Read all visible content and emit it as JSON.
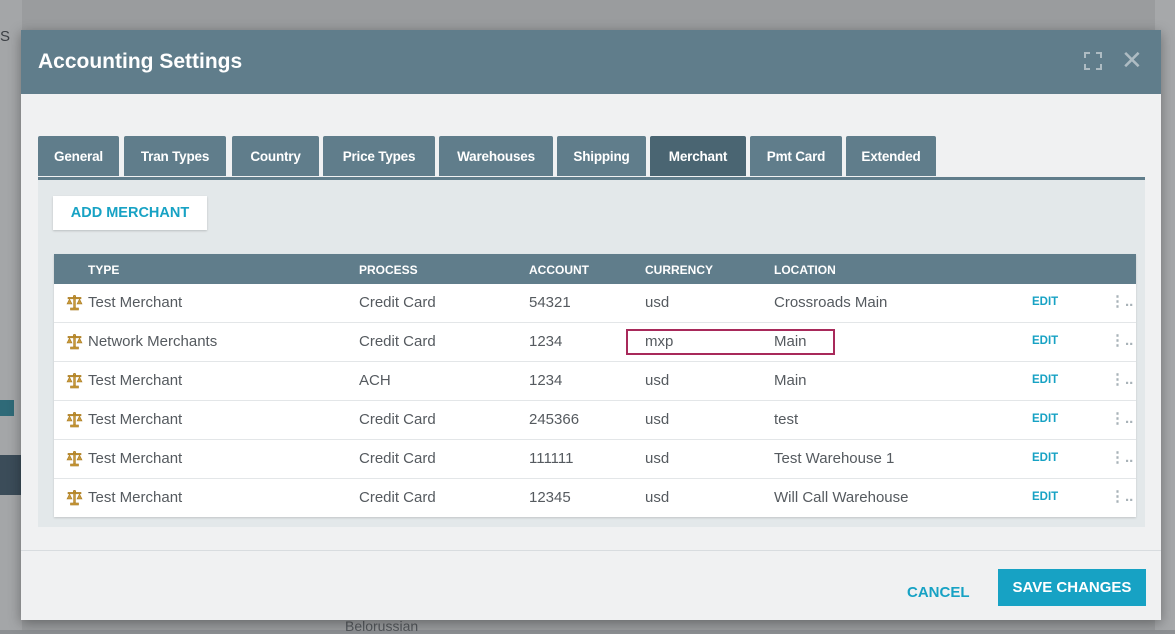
{
  "background": {
    "left_text": "S",
    "bottom_text": "Belorussian"
  },
  "modal": {
    "title": "Accounting Settings",
    "expand_icon": "expand-icon",
    "close_icon": "close-icon"
  },
  "tabs": [
    {
      "label": "General",
      "active": false
    },
    {
      "label": "Tran Types",
      "active": false
    },
    {
      "label": "Country",
      "active": false
    },
    {
      "label": "Price Types",
      "active": false
    },
    {
      "label": "Warehouses",
      "active": false
    },
    {
      "label": "Shipping",
      "active": false
    },
    {
      "label": "Merchant",
      "active": true
    },
    {
      "label": "Pmt Card",
      "active": false
    },
    {
      "label": "Extended",
      "active": false
    }
  ],
  "merchant": {
    "add_label": "ADD MERCHANT",
    "columns": [
      "TYPE",
      "PROCESS",
      "ACCOUNT",
      "CURRENCY",
      "LOCATION"
    ],
    "edit_label": "EDIT",
    "more_icon": "more-options-icon",
    "row_icon": "scales-icon",
    "rows": [
      {
        "type": "Test Merchant",
        "process": "Credit Card",
        "account": "54321",
        "currency": "usd",
        "location": "Crossroads Main"
      },
      {
        "type": "Network Merchants",
        "process": "Credit Card",
        "account": "1234",
        "currency": "mxp",
        "location": "Main"
      },
      {
        "type": "Test Merchant",
        "process": "ACH",
        "account": "1234",
        "currency": "usd",
        "location": "Main"
      },
      {
        "type": "Test Merchant",
        "process": "Credit Card",
        "account": "245366",
        "currency": "usd",
        "location": "test"
      },
      {
        "type": "Test Merchant",
        "process": "Credit Card",
        "account": "111111",
        "currency": "usd",
        "location": "Test Warehouse 1"
      },
      {
        "type": "Test Merchant",
        "process": "Credit Card",
        "account": "12345",
        "currency": "usd",
        "location": "Will Call Warehouse"
      }
    ]
  },
  "footer": {
    "cancel_label": "CANCEL",
    "save_label": "SAVE CHANGES"
  },
  "colors": {
    "header": "#607d8b",
    "accent": "#17a2c4",
    "highlight": "#a8295a"
  }
}
